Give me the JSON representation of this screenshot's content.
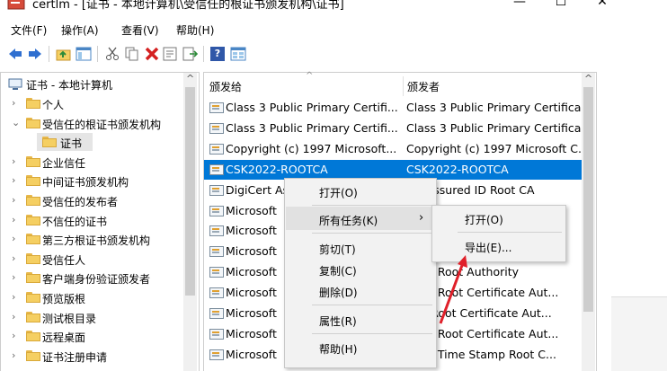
{
  "window": {
    "title": "certlm - [证书 - 本地计算机\\受信任的根证书颁发机构\\证书]",
    "minimize_glyph": "—",
    "maximize_glyph": "☐",
    "close_glyph": "✕"
  },
  "menu": {
    "file": "文件(F)",
    "action": "操作(A)",
    "view": "查看(V)",
    "help": "帮助(H)"
  },
  "toolbar": {
    "icons": [
      "back-arrow-icon",
      "forward-arrow-icon",
      "up-folder-icon",
      "show-hide-tree-icon",
      "cut-icon",
      "copy-icon",
      "delete-icon",
      "properties-icon",
      "export-list-icon",
      "help-icon",
      "console-icon"
    ],
    "help_glyph": "?"
  },
  "tree": {
    "root": "证书 - 本地计算机",
    "items": [
      {
        "label": "个人",
        "chevron": "›"
      },
      {
        "label": "受信任的根证书颁发机构",
        "chevron": "⌄"
      },
      {
        "label": "证书",
        "chevron": ""
      },
      {
        "label": "企业信任",
        "chevron": "›"
      },
      {
        "label": "中间证书颁发机构",
        "chevron": "›"
      },
      {
        "label": "受信任的发布者",
        "chevron": "›"
      },
      {
        "label": "不信任的证书",
        "chevron": "›"
      },
      {
        "label": "第三方根证书颁发机构",
        "chevron": "›"
      },
      {
        "label": "受信任人",
        "chevron": "›"
      },
      {
        "label": "客户端身份验证颁发者",
        "chevron": "›"
      },
      {
        "label": "预览版根",
        "chevron": "›"
      },
      {
        "label": "测试根目录",
        "chevron": "›"
      },
      {
        "label": "远程桌面",
        "chevron": "›"
      },
      {
        "label": "证书注册申请",
        "chevron": "›"
      }
    ],
    "scroll_up": "^"
  },
  "list": {
    "columns": [
      "颁发给",
      "颁发者"
    ],
    "sort_glyph": "^",
    "rows": [
      {
        "issued_to": "Class 3 Public Primary Certifi...",
        "issued_by": "Class 3 Public Primary Certifica..."
      },
      {
        "issued_to": "Class 3 Public Primary Certifi...",
        "issued_by": "Class 3 Public Primary Certifica..."
      },
      {
        "issued_to": "Copyright (c) 1997 Microsoft...",
        "issued_by": "Copyright (c) 1997 Microsoft C..."
      },
      {
        "issued_to": "CSK2022-ROOTCA",
        "issued_by": "CSK2022-ROOTCA"
      },
      {
        "issued_to": "DigiCert As",
        "issued_by": "ert Assured ID Root CA"
      },
      {
        "issued_to": "Microsoft",
        "issued_by": "Ro..."
      },
      {
        "issued_to": "Microsoft",
        "issued_by": "C..."
      },
      {
        "issued_to": "Microsoft",
        "issued_by": "fic..."
      },
      {
        "issued_to": "Microsoft",
        "issued_by": "osoft Root Authority"
      },
      {
        "issued_to": "Microsoft",
        "issued_by": "osoft Root Certificate Aut..."
      },
      {
        "issued_to": "Microsoft",
        "issued_by": "soft Root Certificate Aut..."
      },
      {
        "issued_to": "Microsoft",
        "issued_by": "osoft Root Certificate Aut..."
      },
      {
        "issued_to": "Microsoft",
        "issued_by": "osoft Time Stamp Root C..."
      }
    ],
    "scroll_up": "^"
  },
  "context_menu": {
    "open": "打开(O)",
    "all_tasks": "所有任务(K)",
    "submenu_arrow": "›",
    "cut": "剪切(T)",
    "copy": "复制(C)",
    "delete": "删除(D)",
    "properties": "属性(R)",
    "help": "帮助(H)"
  },
  "submenu": {
    "open": "打开(O)",
    "export": "导出(E)..."
  },
  "colors": {
    "selection": "#0078d7",
    "annotation_arrow": "#e0202a"
  }
}
